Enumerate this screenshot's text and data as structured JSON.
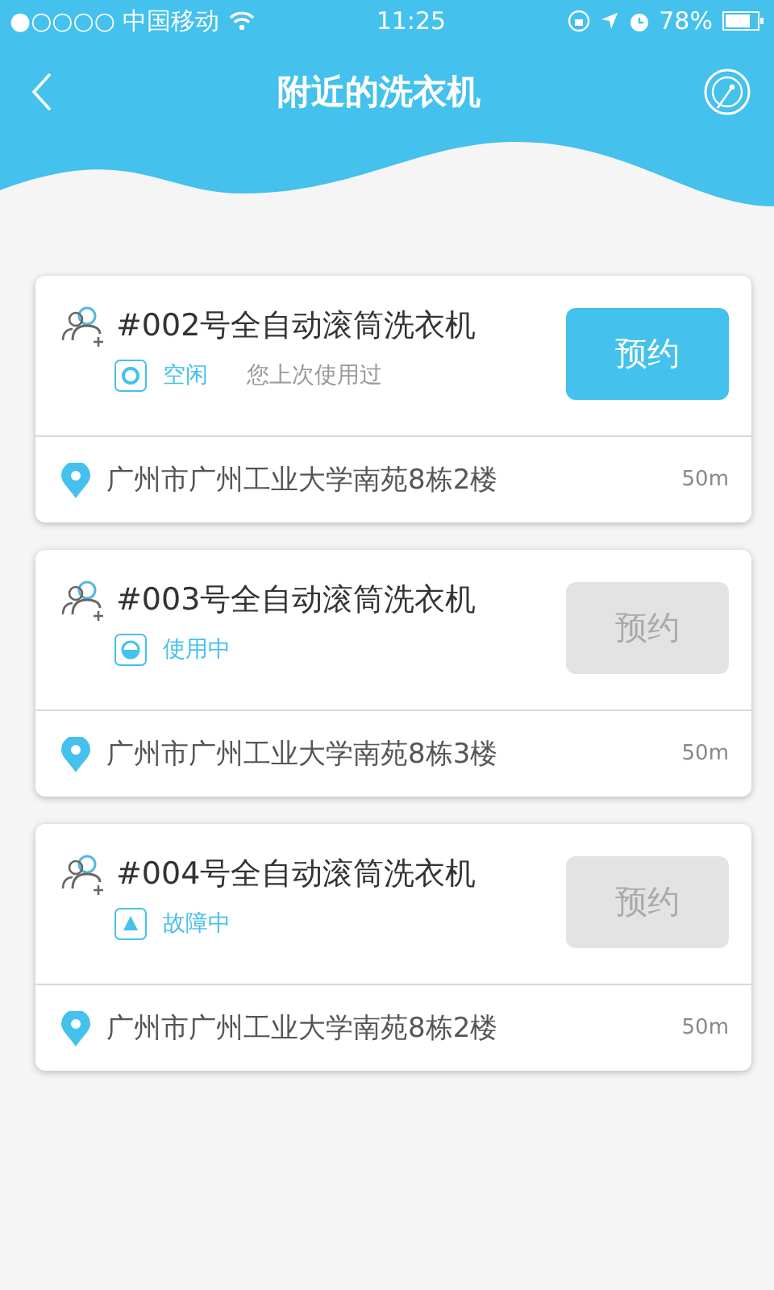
{
  "status_bar": {
    "carrier": "●○○○○ 中国移动",
    "time": "11:25",
    "battery": "78%"
  },
  "header": {
    "title": "附近的洗衣机"
  },
  "machines": [
    {
      "name": "#002号全自动滚筒洗衣机",
      "status": {
        "kind": "idle",
        "label": "空闲"
      },
      "note": "您上次使用过",
      "button": {
        "label": "预约",
        "disabled": false
      },
      "address": "广州市广州工业大学南苑8栋2楼",
      "distance": "50m"
    },
    {
      "name": "#003号全自动滚筒洗衣机",
      "status": {
        "kind": "in_use",
        "label": "使用中"
      },
      "button": {
        "label": "预约",
        "disabled": true
      },
      "address": "广州市广州工业大学南苑8栋3楼",
      "distance": "50m"
    },
    {
      "name": "#004号全自动滚筒洗衣机",
      "status": {
        "kind": "fault",
        "label": "故障中"
      },
      "button": {
        "label": "预约",
        "disabled": true
      },
      "address": "广州市广州工业大学南苑8栋2楼",
      "distance": "50m"
    }
  ]
}
